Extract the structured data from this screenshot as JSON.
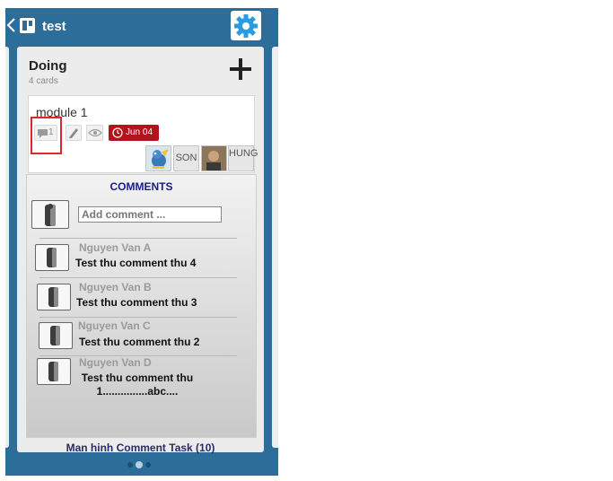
{
  "app": {
    "title": "test"
  },
  "icons": {
    "back": "chevron-left-icon",
    "board": "board-icon",
    "settings": "gear-icon",
    "add": "plus-icon",
    "comment": "speech-bubble-icon",
    "edit": "pencil-icon",
    "watch": "eye-icon",
    "due": "clock-icon",
    "avatar": "person-silhouette-icon"
  },
  "colors": {
    "header": "#2d6d99",
    "due": "#b3141c",
    "highlight": "#e0262e",
    "panel_title": "#1a1a8c"
  },
  "list": {
    "title": "Doing",
    "count": "4 cards",
    "card": {
      "title": "module 1",
      "comment_count": "1",
      "due": "Jun 04",
      "members": [
        "",
        "SON",
        "",
        "HUNG"
      ]
    }
  },
  "comments_panel": {
    "title": "COMMENTS",
    "input_placeholder": "Add comment ...",
    "items": [
      {
        "author": "Nguyen Van A",
        "text": "Test thu comment thu 4"
      },
      {
        "author": "Nguyen Van B",
        "text": "Test thu comment thu 3"
      },
      {
        "author": "Nguyen Van C",
        "text": "Test thu comment thu 2"
      },
      {
        "author": "Nguyen Van D",
        "text": "Test thu comment thu 1...............abc...."
      }
    ]
  },
  "caption": "Man hinh Comment Task (10)",
  "pager": {
    "pages": 3,
    "current": 2
  }
}
